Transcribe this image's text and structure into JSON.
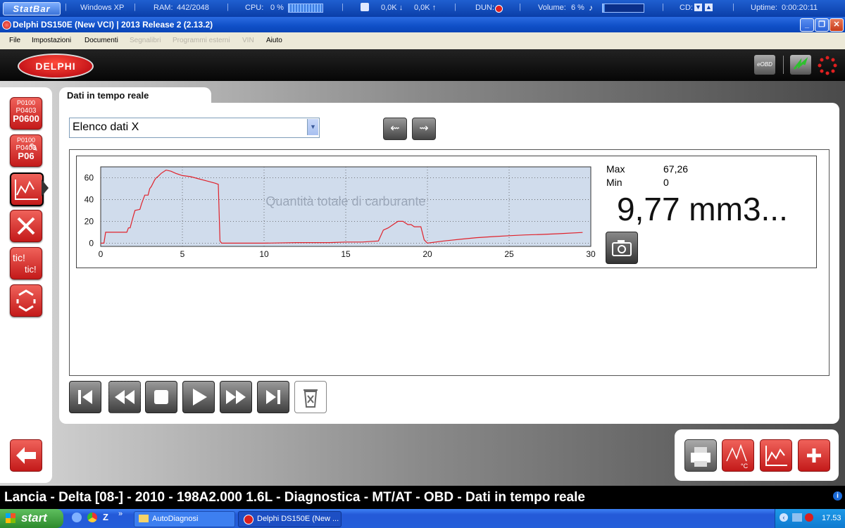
{
  "statbar": {
    "logo": "StatBar",
    "os": "Windows XP",
    "ram_label": "RAM:",
    "ram_value": "442/2048",
    "cpu_label": "CPU:",
    "cpu_value": "0 %",
    "net_down": "0,0K",
    "net_up": "0,0K",
    "dun_label": "DUN:",
    "volume_label": "Volume:",
    "volume_value": "6 %",
    "volume_level": 0.06,
    "cd_label": "CD:",
    "uptime_label": "Uptime:",
    "uptime_value": "0:00:20:11"
  },
  "window": {
    "title": "Delphi DS150E (New VCI)  |  2013 Release 2 (2.13.2)"
  },
  "menu": {
    "items": [
      {
        "label": "File",
        "enabled": true
      },
      {
        "label": "Impostazioni",
        "enabled": true
      },
      {
        "label": "Documenti",
        "enabled": true
      },
      {
        "label": "Segnalibri",
        "enabled": false
      },
      {
        "label": "Programmi esterni",
        "enabled": false
      },
      {
        "label": "VIN",
        "enabled": false
      },
      {
        "label": "Aiuto",
        "enabled": true
      }
    ]
  },
  "header": {
    "brand": "DELPHI",
    "eobd": "eOBD"
  },
  "sidebar": {
    "dtc_codes": [
      "P0100",
      "P0403",
      "P0600"
    ],
    "dtc_codes_2": [
      "P0100",
      "P0403",
      "P06"
    ],
    "tic_label_1": "tic!",
    "tic_label_2": "tic!"
  },
  "tab": {
    "label": "Dati in tempo reale"
  },
  "selector": {
    "value": "Elenco dati X"
  },
  "readout": {
    "max_label": "Max",
    "max_value": "67,26",
    "min_label": "Min",
    "min_value": "0",
    "current": "9,77 mm3..."
  },
  "chart_data": {
    "type": "line",
    "title": "Quantità totale di carburante",
    "xlabel": "",
    "ylabel": "",
    "xlim": [
      0,
      30
    ],
    "ylim": [
      -3,
      70
    ],
    "xticks": [
      "0",
      "5",
      "10",
      "15",
      "20",
      "25",
      "30"
    ],
    "yticks": [
      "0",
      "20",
      "40",
      "60"
    ],
    "grid": true,
    "series": [
      {
        "color": "#e0222b",
        "x": [
          0,
          0.2,
          0.3,
          1.6,
          1.7,
          1.8,
          2.0,
          2.1,
          2.4,
          2.5,
          2.7,
          2.9,
          3.0,
          3.1,
          3.3,
          3.4,
          3.5,
          3.7,
          4.0,
          4.3,
          4.6,
          5.0,
          5.5,
          6.0,
          6.5,
          7.0,
          7.2,
          7.3,
          7.4,
          8,
          10,
          12,
          14,
          15,
          16,
          17.0,
          17.3,
          17.6,
          17.9,
          18.2,
          18.5,
          18.8,
          19.0,
          19.2,
          19.6,
          19.8,
          20.0,
          21,
          22,
          23,
          24,
          25,
          26,
          27,
          28,
          29.5
        ],
        "y": [
          0,
          0,
          10,
          10,
          14,
          14,
          25,
          30,
          31,
          36,
          44,
          44,
          50,
          52,
          58,
          60,
          61,
          64,
          67,
          66,
          64,
          62,
          61,
          59,
          57,
          55,
          54,
          2,
          0,
          0,
          0,
          0.5,
          0.5,
          1,
          1,
          2,
          12,
          14,
          17,
          20,
          20,
          17,
          17,
          15,
          15,
          3,
          0,
          2,
          3.5,
          5,
          6,
          6.8,
          7.5,
          8,
          8.6,
          9.77
        ]
      }
    ]
  },
  "taskbar": {
    "start": "start",
    "tasks": [
      "AutoDiagnosi",
      "Delphi DS150E (New ..."
    ],
    "clock": "17.53"
  },
  "statusline": {
    "text": "Lancia - Delta [08-] - 2010 - 198A2.000 1.6L - Diagnostica - MT/AT - OBD - Dati in tempo reale"
  }
}
